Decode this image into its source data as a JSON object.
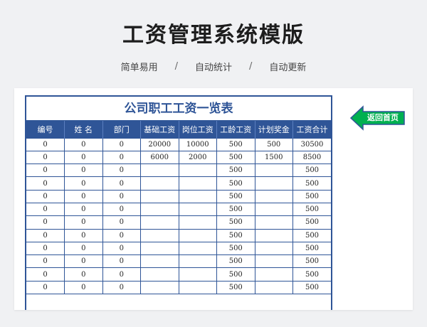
{
  "header": {
    "title": "工资管理系统模版",
    "subtitle": [
      "简单易用",
      "自动统计",
      "自动更新"
    ],
    "separator": "/"
  },
  "sheet": {
    "caption": "公司职工工资一览表",
    "columns": [
      "编号",
      "姓 名",
      "部门",
      "基础工资",
      "岗位工资",
      "工龄工资",
      "计划奖金",
      "工资合计"
    ],
    "rows": [
      [
        "0",
        "0",
        "0",
        "20000",
        "10000",
        "500",
        "500",
        "30500"
      ],
      [
        "0",
        "0",
        "0",
        "6000",
        "2000",
        "500",
        "1500",
        "8500"
      ],
      [
        "0",
        "0",
        "0",
        "",
        "",
        "500",
        "",
        "500"
      ],
      [
        "0",
        "0",
        "0",
        "",
        "",
        "500",
        "",
        "500"
      ],
      [
        "0",
        "0",
        "0",
        "",
        "",
        "500",
        "",
        "500"
      ],
      [
        "0",
        "0",
        "0",
        "",
        "",
        "500",
        "",
        "500"
      ],
      [
        "0",
        "0",
        "0",
        "",
        "",
        "500",
        "",
        "500"
      ],
      [
        "0",
        "0",
        "0",
        "",
        "",
        "500",
        "",
        "500"
      ],
      [
        "0",
        "0",
        "0",
        "",
        "",
        "500",
        "",
        "500"
      ],
      [
        "0",
        "0",
        "0",
        "",
        "",
        "500",
        "",
        "500"
      ],
      [
        "0",
        "0",
        "0",
        "",
        "",
        "500",
        "",
        "500"
      ],
      [
        "0",
        "0",
        "0",
        "",
        "",
        "500",
        "",
        "500"
      ]
    ]
  },
  "back_button": {
    "label": "返回首页",
    "icon": "arrow-left-icon",
    "fill_color": "#00b050",
    "stroke_color": "#2f5597"
  },
  "colors": {
    "table_header": "#2f5597",
    "caption_text": "#2f5597"
  }
}
